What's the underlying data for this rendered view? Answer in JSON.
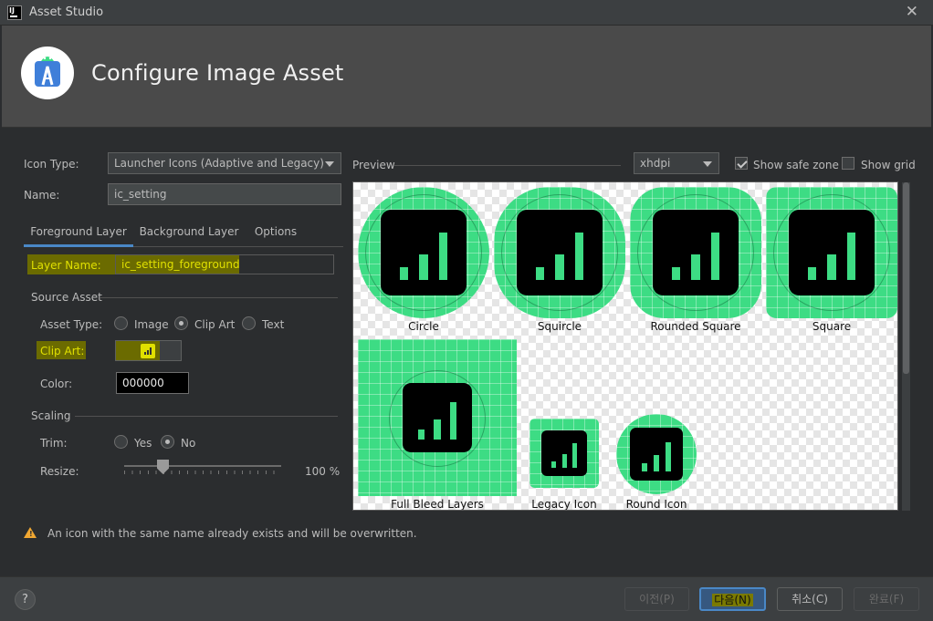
{
  "window": {
    "title": "Asset Studio",
    "close_glyph": "✕",
    "app_icon": "IJ"
  },
  "header": {
    "title": "Configure Image Asset",
    "logo_icon": "android-studio-logo-icon"
  },
  "form": {
    "icon_type_label": "Icon Type:",
    "icon_type_value": "Launcher Icons (Adaptive and Legacy)",
    "name_label": "Name:",
    "name_value": "ic_setting"
  },
  "tabs": [
    {
      "label": "Foreground Layer",
      "active": true
    },
    {
      "label": "Background Layer",
      "active": false
    },
    {
      "label": "Options",
      "active": false
    }
  ],
  "foreground": {
    "layer_name_label": "Layer Name:",
    "layer_name_value": "ic_setting_foreground",
    "source_asset_label": "Source Asset",
    "asset_type_label": "Asset Type:",
    "asset_types": [
      {
        "label": "Image",
        "selected": false
      },
      {
        "label": "Clip Art",
        "selected": true
      },
      {
        "label": "Text",
        "selected": false
      }
    ],
    "clip_art_label": "Clip Art:",
    "clip_art_icon": "signal-cellular-icon",
    "color_label": "Color:",
    "color_value": "000000",
    "scaling_label": "Scaling",
    "trim_label": "Trim:",
    "trim_options": [
      {
        "label": "Yes",
        "selected": false
      },
      {
        "label": "No",
        "selected": true
      }
    ],
    "resize_label": "Resize:",
    "resize_value": "100 %",
    "resize_percent": 100
  },
  "preview": {
    "label": "Preview",
    "density": "xhdpi",
    "show_safe_zone_label": "Show safe zone",
    "show_safe_zone": true,
    "show_grid_label": "Show grid",
    "show_grid": false,
    "items": {
      "circle": "Circle",
      "squircle": "Squircle",
      "rounded_square": "Rounded Square",
      "square": "Square",
      "full_bleed": "Full Bleed Layers",
      "legacy": "Legacy Icon",
      "round": "Round Icon"
    },
    "accent_color": "#3ddc84"
  },
  "warning": {
    "text": "An icon with the same name already exists and will be overwritten."
  },
  "footer": {
    "help_glyph": "?",
    "prev": "이전(P)",
    "next": "다음(N)",
    "cancel": "취소(C)",
    "finish": "완료(F)"
  }
}
